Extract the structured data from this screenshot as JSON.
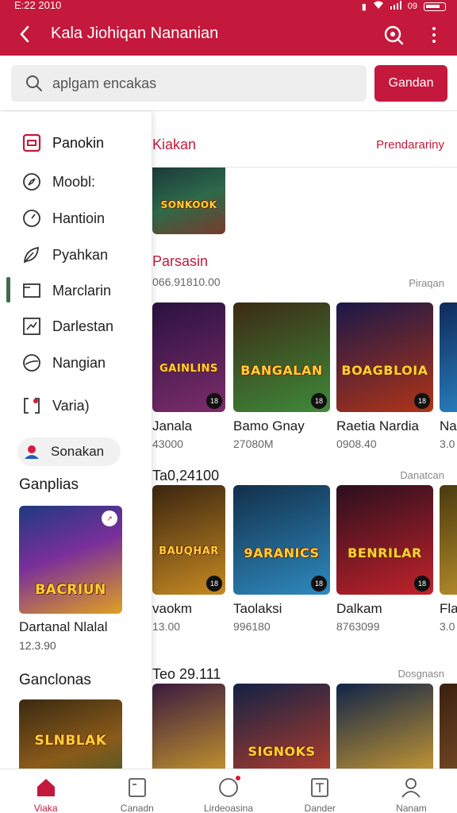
{
  "status": {
    "time": "E:22 2010",
    "battery": "09"
  },
  "app_bar": {
    "title": "Kala Jiohiqan Nananian"
  },
  "search": {
    "placeholder": "aplgam encakas",
    "button_label": "Gandan"
  },
  "drawer": {
    "items": [
      {
        "label": "Panokin",
        "icon": "inbox-icon"
      },
      {
        "label": "Moobl:",
        "icon": "compass-icon"
      },
      {
        "label": "Hantioin",
        "icon": "clock-icon"
      },
      {
        "label": "Pyahkan",
        "icon": "leaf-icon"
      },
      {
        "label": "Marclarin",
        "icon": "window-icon"
      },
      {
        "label": "Darlestan",
        "icon": "chart-icon"
      },
      {
        "label": "Nangian",
        "icon": "globe-icon"
      },
      {
        "label": "Varia)",
        "icon": "bracket-icon"
      }
    ],
    "chip_label": "Sonakan",
    "section1": {
      "title": "Ganplias",
      "card_title": "Dartanal Nlalal",
      "card_sub": "12.3.90",
      "card_logo": "BACRIUN"
    },
    "section2": {
      "title": "Ganclonas",
      "card_logo": "SLNBLAK"
    }
  },
  "main": {
    "title": "Kiakan",
    "filter_label": "Prendarariny",
    "top_thumb_logo": "SONKOOK",
    "sections": [
      {
        "title": "Parsasin",
        "subtitle": "066.91810.00",
        "more": "Piraqan",
        "cards": [
          {
            "title": "Janala",
            "sub": "43000",
            "logo": "GAINLINS",
            "colors": [
              "#2a1240",
              "#7c2d6b"
            ]
          },
          {
            "title": "Bamo Gnay",
            "sub": "27080M",
            "logo": "BANGALAN",
            "colors": [
              "#3c2a14",
              "#3f8a3a"
            ]
          },
          {
            "title": "Raetia Nardia",
            "sub": "0908.40",
            "logo": "BOAGBLOIA",
            "colors": [
              "#1a1848",
              "#b03418"
            ]
          },
          {
            "title": "Nam",
            "sub": "3.0",
            "logo": "T",
            "colors": [
              "#102a5a",
              "#2c8fd0"
            ]
          }
        ]
      },
      {
        "title": "Ta0,24100",
        "subtitle": "",
        "more": "Danatcan",
        "cards": [
          {
            "title": "vaokm",
            "sub": "13.00",
            "logo": "BAUQHAR",
            "colors": [
              "#3a2510",
              "#c68a22"
            ]
          },
          {
            "title": "Taolaksi",
            "sub": "996180",
            "logo": "9ARANICS",
            "colors": [
              "#12304a",
              "#2e8ac0"
            ]
          },
          {
            "title": "Dalkam",
            "sub": "8763099",
            "logo": "BENRILAR",
            "colors": [
              "#2a0f1e",
              "#c2222a"
            ]
          },
          {
            "title": "Fla",
            "sub": "3.0",
            "logo": "",
            "colors": [
              "#4a3a10",
              "#c79a2e"
            ]
          }
        ]
      },
      {
        "title": "Teo 29.111",
        "subtitle": "",
        "more": "Dosgnasn",
        "cards": [
          {
            "title": "",
            "sub": "",
            "logo": "",
            "colors": [
              "#3a1a40",
              "#d9a82a"
            ]
          },
          {
            "title": "",
            "sub": "",
            "logo": "SIGNOKS",
            "colors": [
              "#122244",
              "#c8402a"
            ]
          },
          {
            "title": "",
            "sub": "",
            "logo": "",
            "colors": [
              "#102448",
              "#e0a830"
            ]
          },
          {
            "title": "",
            "sub": "",
            "logo": "",
            "colors": [
              "#3a2010",
              "#8a5a2a"
            ]
          }
        ]
      }
    ]
  },
  "bottom_nav": [
    {
      "label": "Viaka",
      "icon": "home-icon",
      "active": true
    },
    {
      "label": "Canadn",
      "icon": "tablet-icon",
      "active": false
    },
    {
      "label": "Lirdeoasina",
      "icon": "circle-icon",
      "active": false
    },
    {
      "label": "Dander",
      "icon": "document-icon",
      "active": false
    },
    {
      "label": "Nanam",
      "icon": "person-icon",
      "active": false
    }
  ],
  "colors": {
    "brand": "#c4183c",
    "active_indicator": "#3f6b47"
  }
}
